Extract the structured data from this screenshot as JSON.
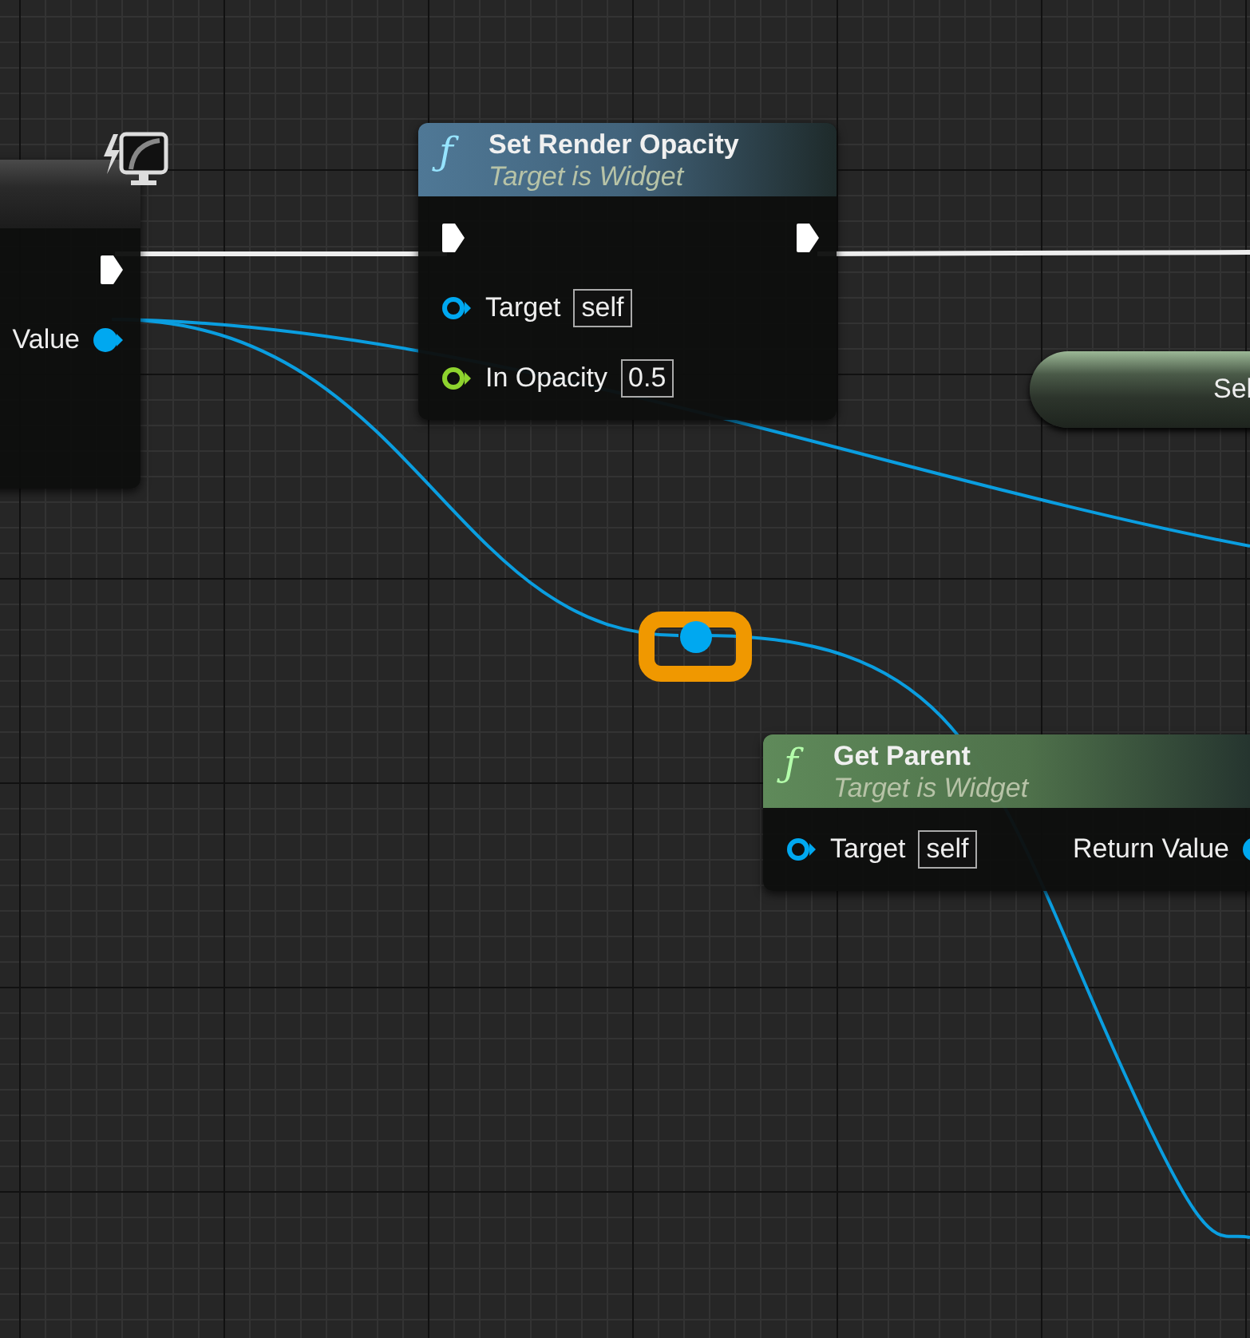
{
  "nodes": [
    {
      "kind": "event",
      "selected": false,
      "outputs": [
        {
          "kind": "exec"
        },
        {
          "kind": "data",
          "label": "Value",
          "color": "#00a8f0",
          "connected": true
        }
      ]
    },
    {
      "kind": "function",
      "selected": false,
      "glyph": "ƒ",
      "title": "Set Render Opacity",
      "subtitle": "Target is Widget",
      "color": "#4f7896",
      "inputs": [
        {
          "kind": "exec"
        },
        {
          "kind": "data",
          "label": "Target",
          "default": "self",
          "color": "#00a8f0",
          "connected": false
        },
        {
          "kind": "data",
          "label": "In Opacity",
          "default": "0.5",
          "color": "#8ed32e",
          "connected": false
        }
      ],
      "outputs": [
        {
          "kind": "exec"
        }
      ]
    },
    {
      "kind": "function",
      "selected": false,
      "glyph": "ƒ",
      "title": "Get Parent",
      "subtitle": "Target is Widget",
      "color": "#5f8a5a",
      "inputs": [
        {
          "kind": "data",
          "label": "Target",
          "default": "self",
          "color": "#00a8f0",
          "connected": false
        }
      ],
      "outputs": [
        {
          "kind": "data",
          "label": "Return Value",
          "color": "#00a8f0",
          "connected": true
        }
      ]
    },
    {
      "kind": "pill",
      "selected": false,
      "label": "Sel"
    },
    {
      "kind": "reroute",
      "selected": true,
      "color": "#00a8f0"
    }
  ]
}
